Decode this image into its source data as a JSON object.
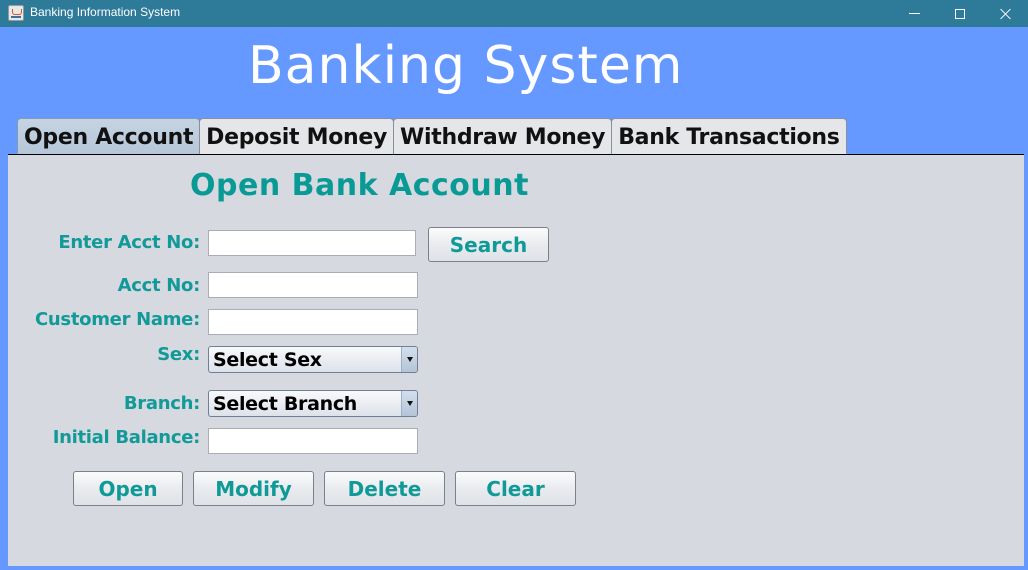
{
  "window": {
    "title": "Banking Information System",
    "controls": {
      "minimize": "minimize",
      "maximize": "maximize",
      "close": "close"
    }
  },
  "header": {
    "title": "Banking System"
  },
  "tabs": [
    {
      "label": "Open Account",
      "active": true
    },
    {
      "label": "Deposit Money",
      "active": false
    },
    {
      "label": "Withdraw Money",
      "active": false
    },
    {
      "label": "Bank Transactions",
      "active": false
    }
  ],
  "form": {
    "title": "Open Bank Account",
    "fields": {
      "enter_acct_no": {
        "label": "Enter Acct No:",
        "value": ""
      },
      "acct_no": {
        "label": "Acct No:",
        "value": ""
      },
      "customer_name": {
        "label": "Customer Name:",
        "value": ""
      },
      "sex": {
        "label": "Sex:",
        "selected": "Select Sex"
      },
      "branch": {
        "label": "Branch:",
        "selected": "Select Branch"
      },
      "initial_balance": {
        "label": "Initial Balance:",
        "value": ""
      }
    },
    "search_label": "Search",
    "buttons": {
      "open": "Open",
      "modify": "Modify",
      "delete": "Delete",
      "clear": "Clear"
    }
  },
  "colors": {
    "titlebar": "#2d7a99",
    "background": "#6699ff",
    "panel": "#d6d9e0",
    "accent_text": "#0a9a96"
  }
}
